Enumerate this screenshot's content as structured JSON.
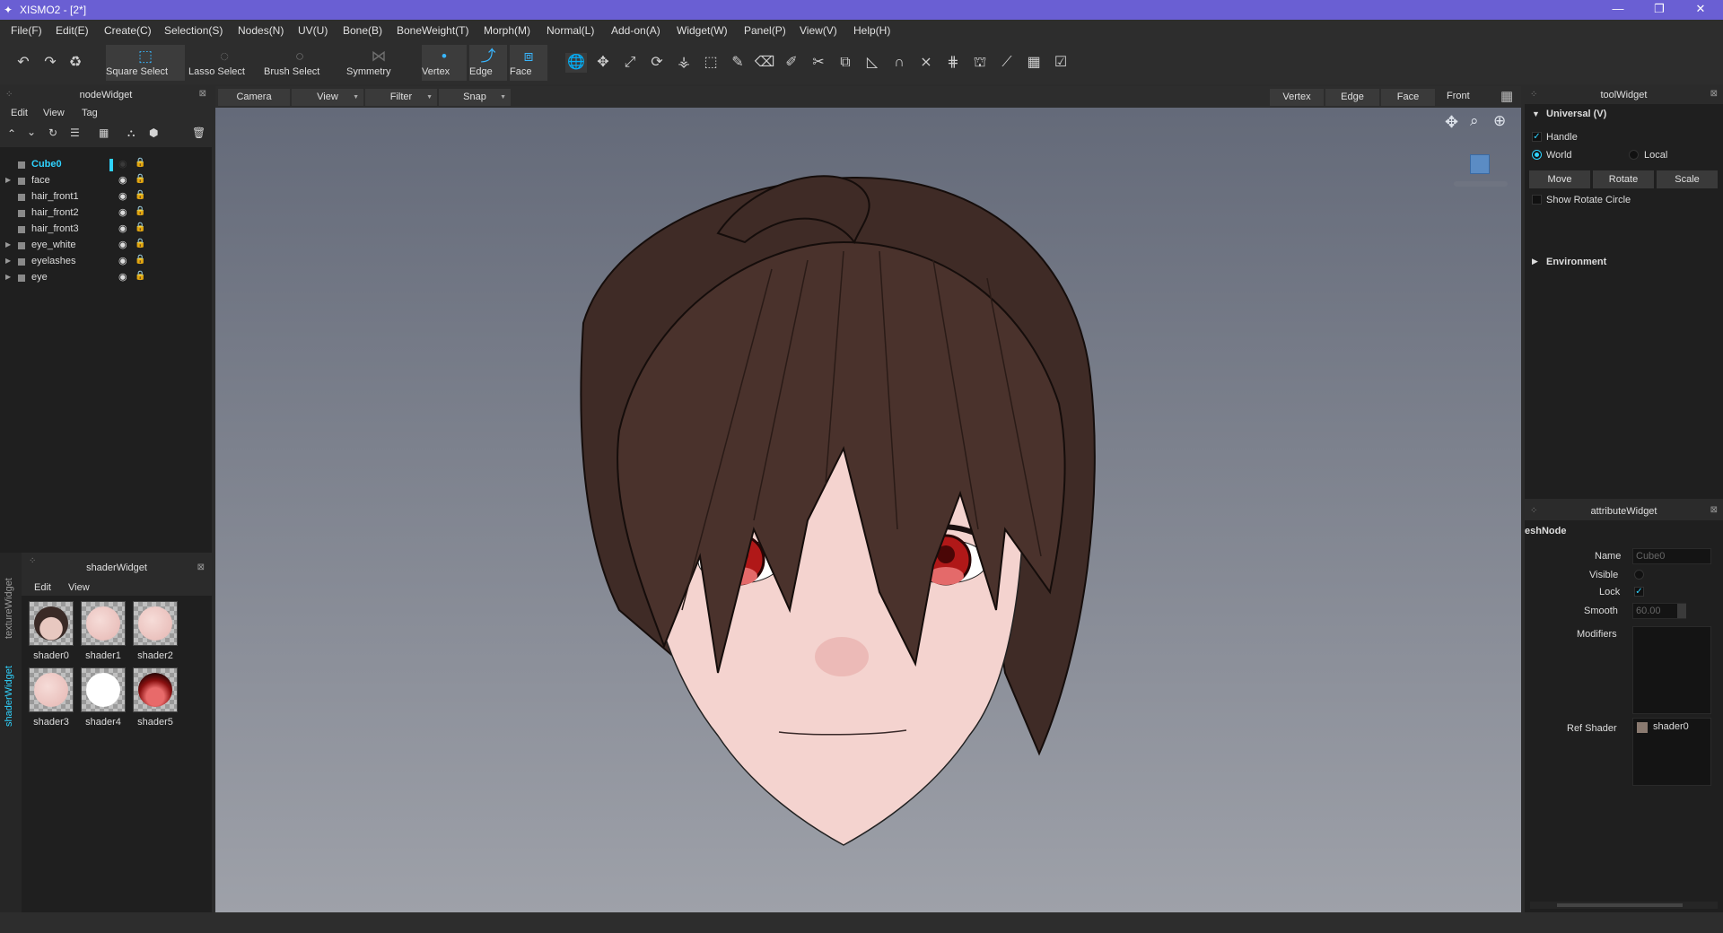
{
  "window": {
    "title": "XISMO2 - [2*]",
    "minimize": "—",
    "maximize": "❐",
    "close": "✕"
  },
  "menus": [
    "File(F)",
    "Edit(E)",
    "Create(C)",
    "Selection(S)",
    "Nodes(N)",
    "UV(U)",
    "Bone(B)",
    "BoneWeight(T)",
    "Morph(M)",
    "Normal(L)",
    "Add-on(A)",
    "Widget(W)",
    "Panel(P)",
    "View(V)",
    "Help(H)"
  ],
  "toolbar": {
    "square_select": "Square Select",
    "lasso_select": "Lasso Select",
    "brush_select": "Brush Select",
    "symmetry": "Symmetry",
    "vertex": "Vertex",
    "edge": "Edge",
    "face": "Face"
  },
  "nodeWidget": {
    "title": "nodeWidget",
    "menu": [
      "Edit",
      "View",
      "Tag"
    ],
    "nodes": [
      {
        "name": "Cube0",
        "selected": true,
        "expandable": false
      },
      {
        "name": "face",
        "expandable": true
      },
      {
        "name": "hair_front1",
        "expandable": false
      },
      {
        "name": "hair_front2",
        "expandable": false
      },
      {
        "name": "hair_front3",
        "expandable": false
      },
      {
        "name": "eye_white",
        "expandable": true
      },
      {
        "name": "eyelashes",
        "expandable": true
      },
      {
        "name": "eye",
        "expandable": true
      }
    ]
  },
  "shaderWidget": {
    "title": "shaderWidget",
    "menu": [
      "Edit",
      "View"
    ],
    "side_tabs": [
      "textureWidget",
      "shaderWidget"
    ],
    "shaders": [
      "shader0",
      "shader1",
      "shader2",
      "shader3",
      "shader4",
      "shader5"
    ]
  },
  "viewport": {
    "buttons": [
      "Camera",
      "View",
      "Filter",
      "Snap"
    ],
    "modes": [
      "Vertex",
      "Edge",
      "Face"
    ],
    "projection": "Front"
  },
  "toolWidget": {
    "title": "toolWidget",
    "universal": "Universal (V)",
    "handle": "Handle",
    "world": "World",
    "local": "Local",
    "move": "Move",
    "rotate": "Rotate",
    "scale": "Scale",
    "show_rotate_circle": "Show Rotate Circle",
    "environment": "Environment"
  },
  "attributeWidget": {
    "title": "attributeWidget",
    "section": "eshNode",
    "name_label": "Name",
    "name_value": "Cube0",
    "visible_label": "Visible",
    "lock_label": "Lock",
    "smooth_label": "Smooth",
    "smooth_value": "60.00",
    "modifiers_label": "Modifiers",
    "ref_shader_label": "Ref Shader",
    "ref_shader_value": "shader0"
  },
  "colors": {
    "accent": "#2fd3ff",
    "titlebar": "#6a5fd3",
    "panel_bg": "#1f1f1f"
  }
}
